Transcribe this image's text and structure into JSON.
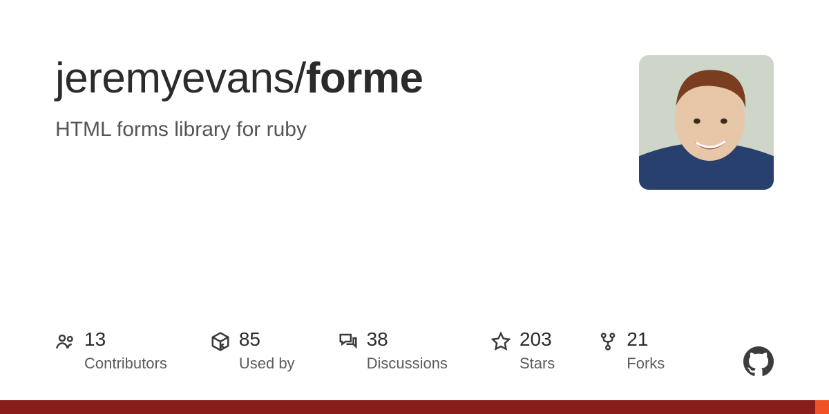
{
  "repo": {
    "owner": "jeremyevans",
    "name": "forme",
    "description": "HTML forms library for ruby"
  },
  "stats": {
    "contributors": {
      "value": "13",
      "label": "Contributors"
    },
    "usedby": {
      "value": "85",
      "label": "Used by"
    },
    "discussions": {
      "value": "38",
      "label": "Discussions"
    },
    "stars": {
      "value": "203",
      "label": "Stars"
    },
    "forks": {
      "value": "21",
      "label": "Forks"
    }
  },
  "colors": {
    "bar": "#8a1c1c",
    "accent": "#f05223"
  }
}
